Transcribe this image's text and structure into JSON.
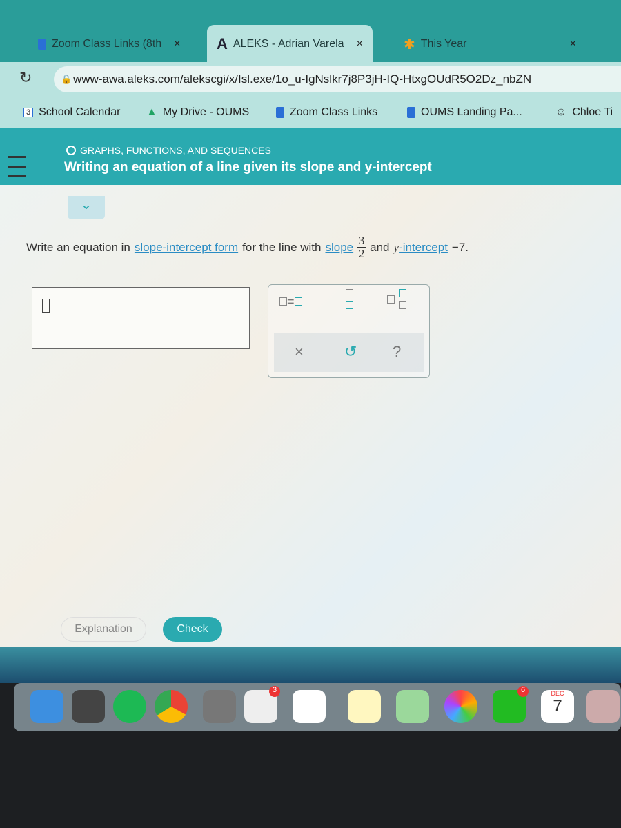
{
  "browser": {
    "tabs": [
      {
        "label": "Zoom Class Links (8th",
        "close": "×"
      },
      {
        "label": "ALEKS - Adrian Varela",
        "close": "×",
        "icon": "A"
      },
      {
        "label": "This Year",
        "close": "×"
      }
    ],
    "url": "www-awa.aleks.com/alekscgi/x/Isl.exe/1o_u-IgNslkr7j8P3jH-IQ-HtxgOUdR5O2Dz_nbZN",
    "bookmarks": [
      {
        "label": "School Calendar",
        "icon_text": "3"
      },
      {
        "label": "My Drive - OUMS"
      },
      {
        "label": "Zoom Class Links"
      },
      {
        "label": "OUMS Landing Pa..."
      },
      {
        "label": "Chloe Ti"
      }
    ]
  },
  "header": {
    "section": "GRAPHS, FUNCTIONS, AND SEQUENCES",
    "title": "Writing an equation of a line given its slope and y-intercept"
  },
  "question": {
    "p1": "Write an equation in",
    "link1": "slope-intercept form",
    "p2": "for the line with",
    "link2": "slope",
    "num": "3",
    "den": "2",
    "p3": "and",
    "yvar": "y",
    "link3": "-intercept",
    "p4": "−7."
  },
  "palette": {
    "undo": "↺",
    "clear": "×",
    "help": "?"
  },
  "buttons": {
    "explanation": "Explanation",
    "check": "Check"
  },
  "dock": {
    "badge1": "3",
    "badge2": "6",
    "cal_month": "DEC",
    "cal_day": "7"
  },
  "colors": {
    "teal": "#2aaab0",
    "link": "#2a8cc4"
  }
}
